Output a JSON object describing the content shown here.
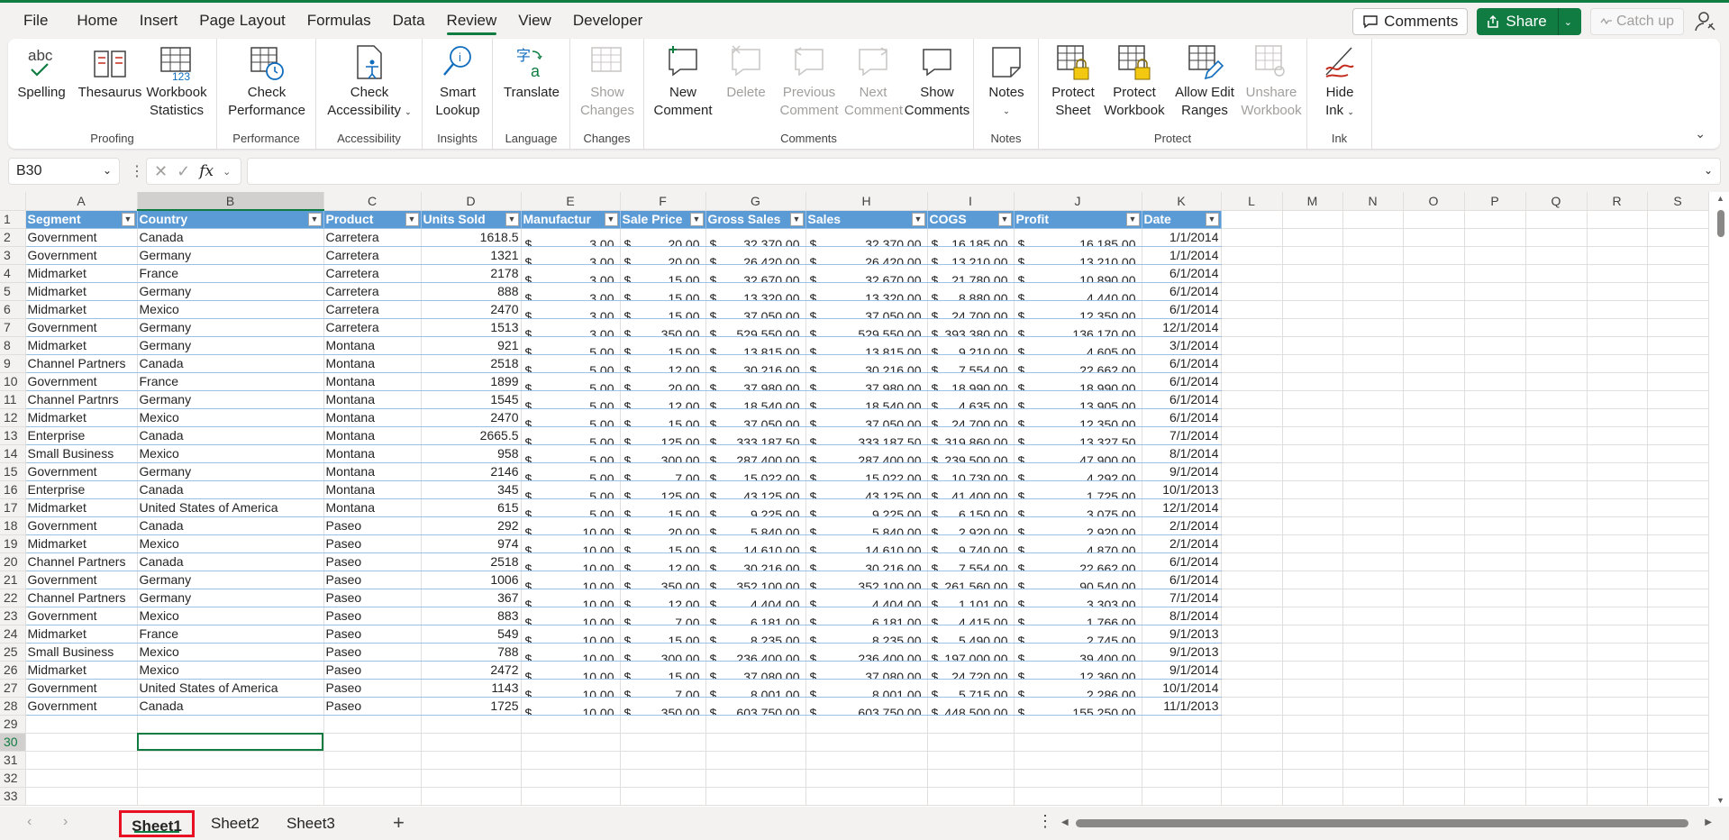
{
  "menu": {
    "items": [
      "File",
      "Home",
      "Insert",
      "Page Layout",
      "Formulas",
      "Data",
      "Review",
      "View",
      "Developer"
    ],
    "active": "Review",
    "comments_label": "Comments",
    "share_label": "Share",
    "catchup_label": "Catch up"
  },
  "ribbon": {
    "groups": {
      "proofing": "Proofing",
      "performance": "Performance",
      "accessibility": "Accessibility",
      "insights": "Insights",
      "language": "Language",
      "changes": "Changes",
      "comments": "Comments",
      "notes": "Notes",
      "protect": "Protect",
      "ink": "Ink"
    },
    "buttons": {
      "spelling": "Spelling",
      "thesaurus": "Thesaurus",
      "workbook_statistics_1": "Workbook",
      "workbook_statistics_2": "Statistics",
      "check_performance_1": "Check",
      "check_performance_2": "Performance",
      "check_accessibility_1": "Check",
      "check_accessibility_2": "Accessibility",
      "smart_lookup_1": "Smart",
      "smart_lookup_2": "Lookup",
      "translate": "Translate",
      "show_changes_1": "Show",
      "show_changes_2": "Changes",
      "new_comment_1": "New",
      "new_comment_2": "Comment",
      "delete": "Delete",
      "previous_comment_1": "Previous",
      "previous_comment_2": "Comment",
      "next_comment_1": "Next",
      "next_comment_2": "Comment",
      "show_comments_1": "Show",
      "show_comments_2": "Comments",
      "notes": "Notes",
      "protect_sheet_1": "Protect",
      "protect_sheet_2": "Sheet",
      "protect_workbook_1": "Protect",
      "protect_workbook_2": "Workbook",
      "allow_edit_ranges_1": "Allow Edit",
      "allow_edit_ranges_2": "Ranges",
      "unshare_workbook_1": "Unshare",
      "unshare_workbook_2": "Workbook",
      "hide_ink_1": "Hide",
      "hide_ink_2": "Ink"
    }
  },
  "formula_bar": {
    "name_box": "B30",
    "fx": "fx",
    "formula": ""
  },
  "grid": {
    "columns": [
      "A",
      "B",
      "C",
      "D",
      "E",
      "F",
      "G",
      "H",
      "I",
      "J",
      "K",
      "L",
      "M",
      "N",
      "O",
      "P",
      "Q",
      "R",
      "S"
    ],
    "selected_column": "B",
    "selected_row": 30,
    "table_headers": [
      "Segment",
      "Country",
      "Product",
      "Units Sold",
      "Manufactur",
      "Sale Price",
      "Gross Sales",
      "Sales",
      "COGS",
      "Profit",
      "Date"
    ],
    "rows": [
      [
        "Government",
        "Canada",
        "Carretera",
        "1618.5",
        "3.00",
        "20.00",
        "32,370.00",
        "32,370.00",
        "16,185.00",
        "16,185.00",
        "1/1/2014"
      ],
      [
        "Government",
        "Germany",
        "Carretera",
        "1321",
        "3.00",
        "20.00",
        "26,420.00",
        "26,420.00",
        "13,210.00",
        "13,210.00",
        "1/1/2014"
      ],
      [
        "Midmarket",
        "France",
        "Carretera",
        "2178",
        "3.00",
        "15.00",
        "32,670.00",
        "32,670.00",
        "21,780.00",
        "10,890.00",
        "6/1/2014"
      ],
      [
        "Midmarket",
        "Germany",
        "Carretera",
        "888",
        "3.00",
        "15.00",
        "13,320.00",
        "13,320.00",
        "8,880.00",
        "4,440.00",
        "6/1/2014"
      ],
      [
        "Midmarket",
        "Mexico",
        "Carretera",
        "2470",
        "3.00",
        "15.00",
        "37,050.00",
        "37,050.00",
        "24,700.00",
        "12,350.00",
        "6/1/2014"
      ],
      [
        "Government",
        "Germany",
        "Carretera",
        "1513",
        "3.00",
        "350.00",
        "529,550.00",
        "529,550.00",
        "393,380.00",
        "136,170.00",
        "12/1/2014"
      ],
      [
        "Midmarket",
        "Germany",
        "Montana",
        "921",
        "5.00",
        "15.00",
        "13,815.00",
        "13,815.00",
        "9,210.00",
        "4,605.00",
        "3/1/2014"
      ],
      [
        "Channel Partners",
        "Canada",
        "Montana",
        "2518",
        "5.00",
        "12.00",
        "30,216.00",
        "30,216.00",
        "7,554.00",
        "22,662.00",
        "6/1/2014"
      ],
      [
        "Government",
        "France",
        "Montana",
        "1899",
        "5.00",
        "20.00",
        "37,980.00",
        "37,980.00",
        "18,990.00",
        "18,990.00",
        "6/1/2014"
      ],
      [
        "Channel Partnrs",
        "Germany",
        "Montana",
        "1545",
        "5.00",
        "12.00",
        "18,540.00",
        "18,540.00",
        "4,635.00",
        "13,905.00",
        "6/1/2014"
      ],
      [
        "Midmarket",
        "Mexico",
        "Montana",
        "2470",
        "5.00",
        "15.00",
        "37,050.00",
        "37,050.00",
        "24,700.00",
        "12,350.00",
        "6/1/2014"
      ],
      [
        "Enterprise",
        "Canada",
        "Montana",
        "2665.5",
        "5.00",
        "125.00",
        "333,187.50",
        "333,187.50",
        "319,860.00",
        "13,327.50",
        "7/1/2014"
      ],
      [
        "Small Business",
        "Mexico",
        "Montana",
        "958",
        "5.00",
        "300.00",
        "287,400.00",
        "287,400.00",
        "239,500.00",
        "47,900.00",
        "8/1/2014"
      ],
      [
        "Government",
        "Germany",
        "Montana",
        "2146",
        "5.00",
        "7.00",
        "15,022.00",
        "15,022.00",
        "10,730.00",
        "4,292.00",
        "9/1/2014"
      ],
      [
        "Enterprise",
        "Canada",
        "Montana",
        "345",
        "5.00",
        "125.00",
        "43,125.00",
        "43,125.00",
        "41,400.00",
        "1,725.00",
        "10/1/2013"
      ],
      [
        "Midmarket",
        "United States of America",
        "Montana",
        "615",
        "5.00",
        "15.00",
        "9,225.00",
        "9,225.00",
        "6,150.00",
        "3,075.00",
        "12/1/2014"
      ],
      [
        "Government",
        "Canada",
        "Paseo",
        "292",
        "10.00",
        "20.00",
        "5,840.00",
        "5,840.00",
        "2,920.00",
        "2,920.00",
        "2/1/2014"
      ],
      [
        "Midmarket",
        "Mexico",
        "Paseo",
        "974",
        "10.00",
        "15.00",
        "14,610.00",
        "14,610.00",
        "9,740.00",
        "4,870.00",
        "2/1/2014"
      ],
      [
        "Channel Partners",
        "Canada",
        "Paseo",
        "2518",
        "10.00",
        "12.00",
        "30,216.00",
        "30,216.00",
        "7,554.00",
        "22,662.00",
        "6/1/2014"
      ],
      [
        "Government",
        "Germany",
        "Paseo",
        "1006",
        "10.00",
        "350.00",
        "352,100.00",
        "352,100.00",
        "261,560.00",
        "90,540.00",
        "6/1/2014"
      ],
      [
        "Channel Partners",
        "Germany",
        "Paseo",
        "367",
        "10.00",
        "12.00",
        "4,404.00",
        "4,404.00",
        "1,101.00",
        "3,303.00",
        "7/1/2014"
      ],
      [
        "Government",
        "Mexico",
        "Paseo",
        "883",
        "10.00",
        "7.00",
        "6,181.00",
        "6,181.00",
        "4,415.00",
        "1,766.00",
        "8/1/2014"
      ],
      [
        "Midmarket",
        "France",
        "Paseo",
        "549",
        "10.00",
        "15.00",
        "8,235.00",
        "8,235.00",
        "5,490.00",
        "2,745.00",
        "9/1/2013"
      ],
      [
        "Small Business",
        "Mexico",
        "Paseo",
        "788",
        "10.00",
        "300.00",
        "236,400.00",
        "236,400.00",
        "197,000.00",
        "39,400.00",
        "9/1/2013"
      ],
      [
        "Midmarket",
        "Mexico",
        "Paseo",
        "2472",
        "10.00",
        "15.00",
        "37,080.00",
        "37,080.00",
        "24,720.00",
        "12,360.00",
        "9/1/2014"
      ],
      [
        "Government",
        "United States of America",
        "Paseo",
        "1143",
        "10.00",
        "7.00",
        "8,001.00",
        "8,001.00",
        "5,715.00",
        "2,286.00",
        "10/1/2014"
      ],
      [
        "Government",
        "Canada",
        "Paseo",
        "1725",
        "10.00",
        "350.00",
        "603,750.00",
        "603,750.00",
        "448,500.00",
        "155,250.00",
        "11/1/2013"
      ]
    ],
    "currency_symbol": "$",
    "empty_rows": [
      29,
      30,
      31,
      32,
      33
    ]
  },
  "sheets": {
    "tabs": [
      "Sheet1",
      "Sheet2",
      "Sheet3"
    ],
    "active": "Sheet1"
  },
  "colors": {
    "accent": "#107c41",
    "table_header": "#5b9bd5",
    "highlight_border": "#e81123"
  }
}
